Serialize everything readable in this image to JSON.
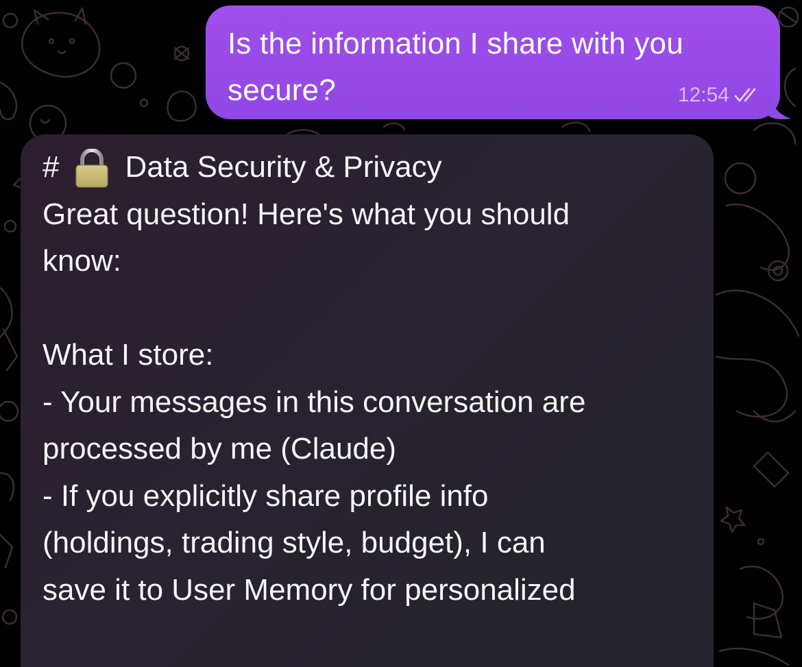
{
  "outgoing_message": {
    "line1": "Is the information I share with you",
    "line2": "secure?",
    "time": "12:54",
    "status_icon": "double-check-icon"
  },
  "incoming_message": {
    "heading_prefix": "#",
    "heading_icon": "lock-icon",
    "heading_text": "Data Security & Privacy",
    "lines": [
      "Great question! Here's what you should",
      "know:",
      "",
      "What I store:",
      "- Your messages in this conversation are",
      "processed by me (Claude)",
      "- If you explicitly share profile info",
      "(holdings, trading style, budget), I can",
      "save it to User Memory for personalized"
    ]
  },
  "colors": {
    "background": "#000000",
    "outgoing_bubble": "#9a4be8",
    "incoming_bubble": "#2a2230",
    "text": "#ffffff",
    "pattern": "#3a2a33"
  }
}
